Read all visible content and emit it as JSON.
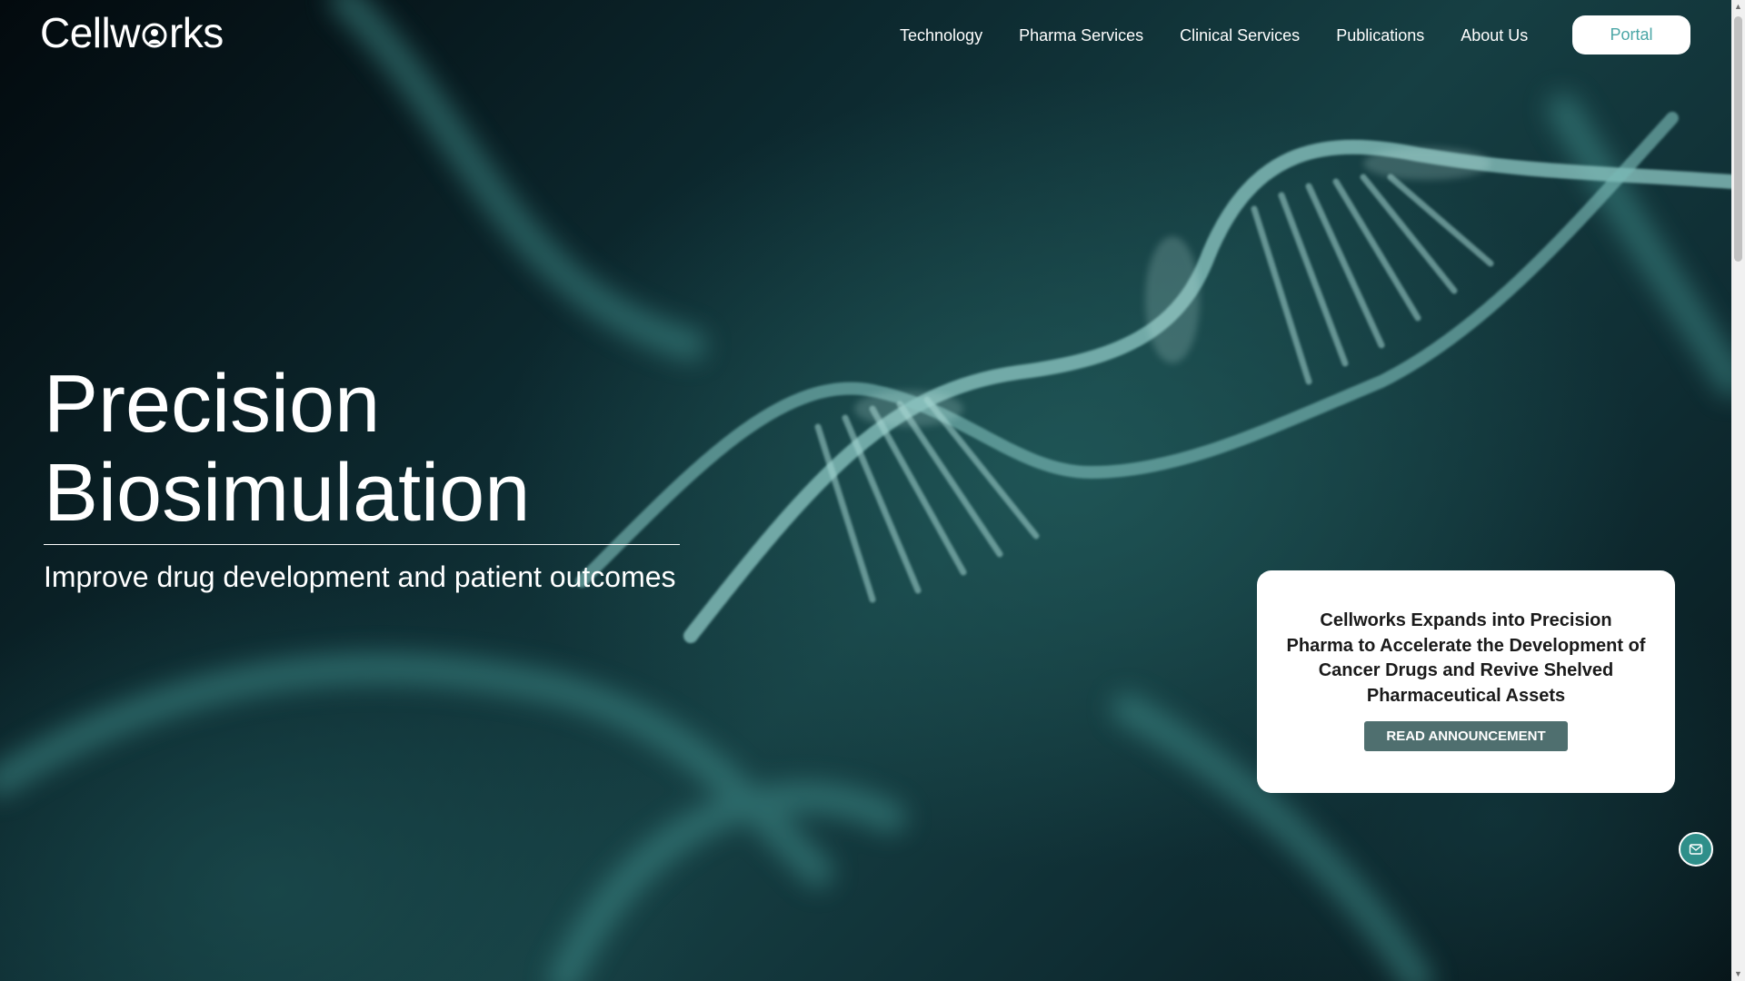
{
  "brand": {
    "logo_text_prefix": "Cellw",
    "logo_text_suffix": "rks"
  },
  "nav": {
    "items": [
      {
        "label": "Technology"
      },
      {
        "label": "Pharma Services"
      },
      {
        "label": "Clinical Services"
      },
      {
        "label": "Publications"
      },
      {
        "label": "About Us"
      }
    ],
    "portal_label": "Portal"
  },
  "hero": {
    "headline_line1": "Precision",
    "headline_line2": "Biosimulation",
    "subtitle": "Improve drug development and patient outcomes"
  },
  "announcement": {
    "text": "Cellworks Expands into Precision Pharma to Accelerate the Development of Cancer Drugs and Revive Shelved Pharmaceutical Assets",
    "button_label": "READ ANNOUNCEMENT"
  },
  "icons": {
    "mail": "mail-icon",
    "logo_o": "cell-logo-icon"
  },
  "colors": {
    "accent_teal": "#4aa6a6",
    "button_slate": "#4f6f6f",
    "mail_button": "#2f8f8a"
  }
}
